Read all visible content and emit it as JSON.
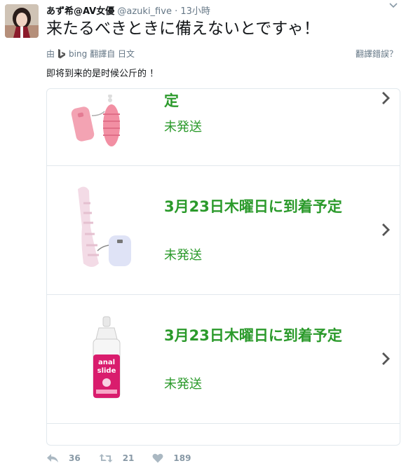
{
  "tweet": {
    "display_name": "あず希@AV女優",
    "handle": "@azuki_five",
    "separator": "·",
    "time": "13小時",
    "text": "来たるべきときに備えないとですゃ！",
    "translation": {
      "by_prefix": "由",
      "provider": "bing",
      "suffix": "翻譯自 日文",
      "wrong_label": "翻譯錯誤？",
      "text": "即将到来的是时候公斤的 ！"
    }
  },
  "orders": [
    {
      "title": "定",
      "status": "未発送"
    },
    {
      "title": "3月23日木曜日に到着予定",
      "status": "未発送"
    },
    {
      "title": "3月23日木曜日に到着予定",
      "status": "未発送"
    }
  ],
  "product_label": {
    "line1": "anal",
    "line2": "slide"
  },
  "actions": {
    "reply_count": "36",
    "retweet_count": "21",
    "like_count": "189"
  },
  "colors": {
    "status_green": "#2b9a2b",
    "meta_gray": "#657786",
    "icon_gray": "#8899a6"
  }
}
